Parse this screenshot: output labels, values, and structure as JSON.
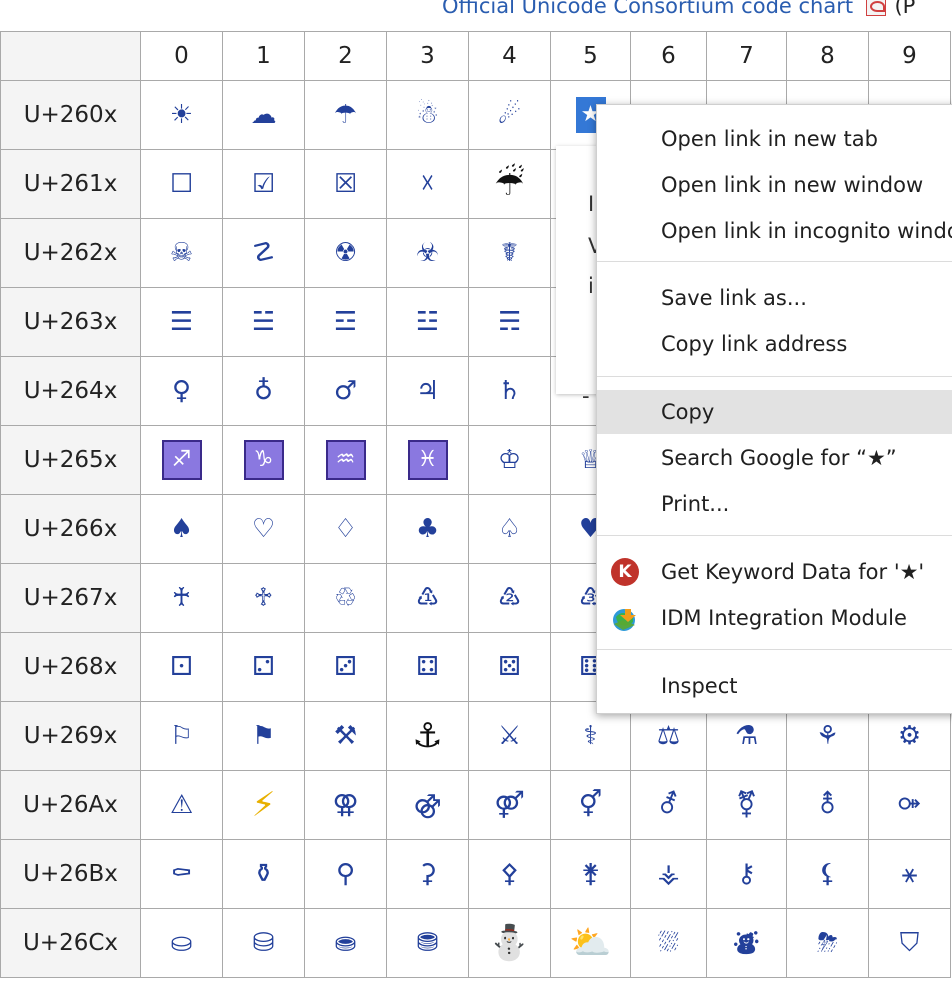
{
  "header": {
    "link_text": "Official Unicode Consortium code chart",
    "link_suffix": "(P",
    "pdf_icon": "pdf-icon"
  },
  "table": {
    "columns": [
      "0",
      "1",
      "2",
      "3",
      "4",
      "5",
      "6",
      "7",
      "8",
      "9"
    ],
    "rows": [
      {
        "label": "U+260x",
        "cells": [
          "☀",
          "☁",
          "☂",
          "☃",
          "☄",
          "★",
          "",
          "",
          "",
          ""
        ]
      },
      {
        "label": "U+261x",
        "cells": [
          "☐",
          "☑",
          "☒",
          "☓",
          "☔",
          "",
          "",
          "",
          "",
          ""
        ]
      },
      {
        "label": "U+262x",
        "cells": [
          "☠",
          "☡",
          "☢",
          "☣",
          "☤",
          "",
          "",
          "",
          "",
          ""
        ]
      },
      {
        "label": "U+263x",
        "cells": [
          "☰",
          "☱",
          "☲",
          "☳",
          "☴",
          "",
          "",
          "",
          "",
          ""
        ]
      },
      {
        "label": "U+264x",
        "cells": [
          "♀",
          "♁",
          "♂",
          "♃",
          "♄",
          "",
          "",
          "",
          "",
          ""
        ]
      },
      {
        "label": "U+265x",
        "cells": [
          "♐",
          "♑",
          "♒",
          "♓",
          "♔",
          "♕",
          "",
          "",
          "",
          ""
        ]
      },
      {
        "label": "U+266x",
        "cells": [
          "♠",
          "♡",
          "♢",
          "♣",
          "♤",
          "♥",
          "",
          "",
          "",
          ""
        ]
      },
      {
        "label": "U+267x",
        "cells": [
          "♰",
          "♱",
          "♲",
          "♳",
          "♴",
          "♵",
          "",
          "",
          "",
          ""
        ]
      },
      {
        "label": "U+268x",
        "cells": [
          "⚀",
          "⚁",
          "⚂",
          "⚃",
          "⚄",
          "⚅",
          "",
          "",
          "",
          ""
        ]
      },
      {
        "label": "U+269x",
        "cells": [
          "⚐",
          "⚑",
          "⚒",
          "⚓",
          "⚔",
          "⚕",
          "⚖",
          "⚗",
          "⚘",
          "⚙"
        ]
      },
      {
        "label": "U+26Ax",
        "cells": [
          "⚠",
          "⚡",
          "⚢",
          "⚣",
          "⚤",
          "⚥",
          "⚦",
          "⚧",
          "⚨",
          "⚩"
        ]
      },
      {
        "label": "U+26Bx",
        "cells": [
          "⚰",
          "⚱",
          "⚲",
          "⚳",
          "⚴",
          "⚵",
          "⚶",
          "⚷",
          "⚸",
          "⚹"
        ]
      },
      {
        "label": "U+26Cx",
        "cells": [
          "⛀",
          "⛁",
          "⛂",
          "⛃",
          "⛄",
          "⛅",
          "⛆",
          "⛇",
          "⛈",
          "⛉"
        ]
      }
    ]
  },
  "tooltip": {
    "line1": "I",
    "line2": "V",
    "line3": "i",
    "line4": "-"
  },
  "context_menu": {
    "items": [
      {
        "label": "Open link in new tab"
      },
      {
        "label": "Open link in new window"
      },
      {
        "label": "Open link in incognito window"
      },
      {
        "label": "Save link as..."
      },
      {
        "label": "Copy link address"
      },
      {
        "label": "Copy"
      },
      {
        "label": "Search Google for “★”"
      },
      {
        "label": "Print..."
      },
      {
        "label": "Get Keyword Data for '★'",
        "icon": "keyword-k-icon",
        "icon_letter": "K"
      },
      {
        "label": "IDM Integration Module",
        "icon": "idm-globe-icon"
      },
      {
        "label": "Inspect"
      }
    ]
  },
  "colors": {
    "glyph": "#23409a",
    "zodiac_bg": "#8a78e0",
    "selected_bg": "#3478d6",
    "menu_hover": "#e2e2e2",
    "link": "#2a5db0"
  }
}
